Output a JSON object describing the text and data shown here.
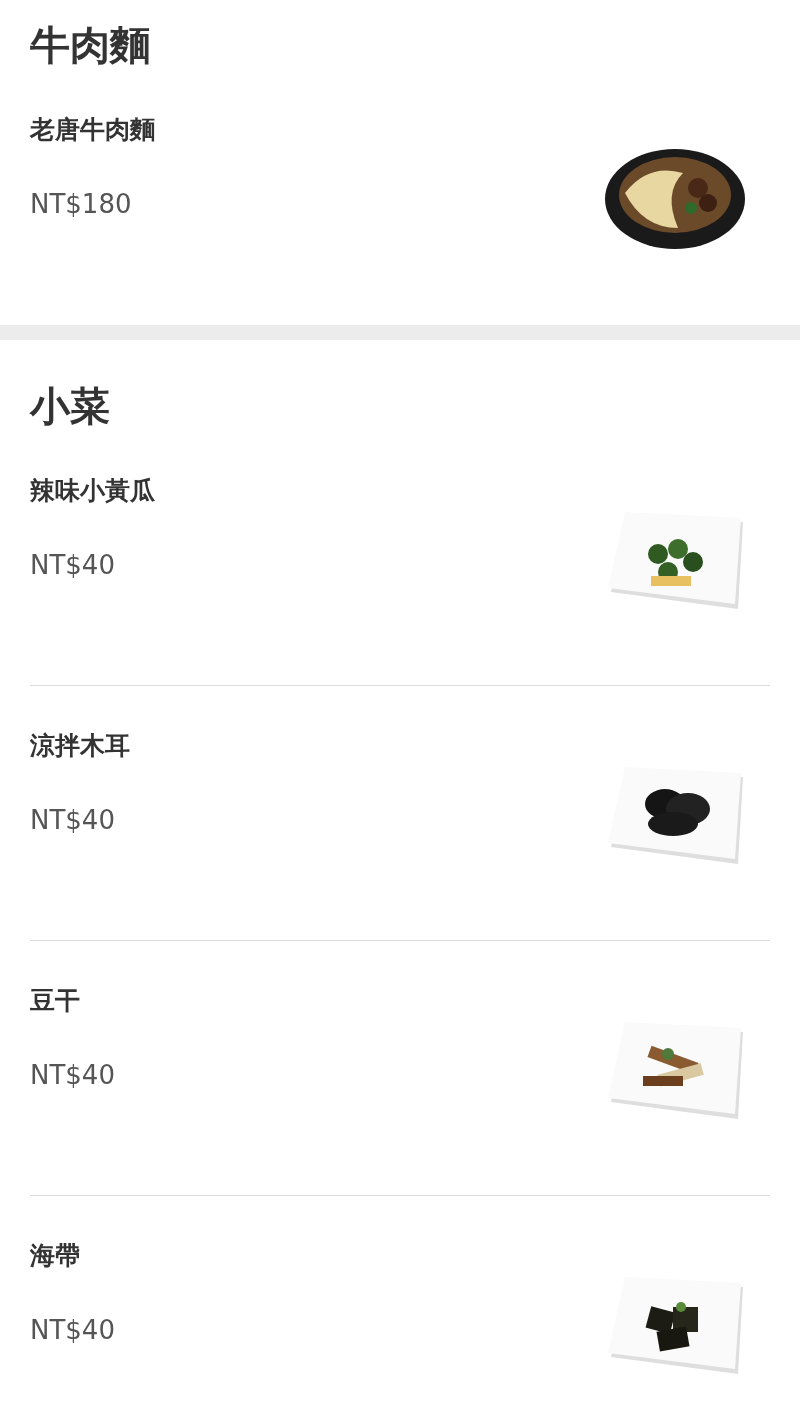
{
  "sections": [
    {
      "title": "牛肉麵",
      "items": [
        {
          "name": "老唐牛肉麵",
          "price": "NT$180"
        }
      ]
    },
    {
      "title": "小菜",
      "items": [
        {
          "name": "辣味小黃瓜",
          "price": "NT$40"
        },
        {
          "name": "涼拌木耳",
          "price": "NT$40"
        },
        {
          "name": "豆干",
          "price": "NT$40"
        },
        {
          "name": "海帶",
          "price": "NT$40"
        }
      ]
    }
  ]
}
